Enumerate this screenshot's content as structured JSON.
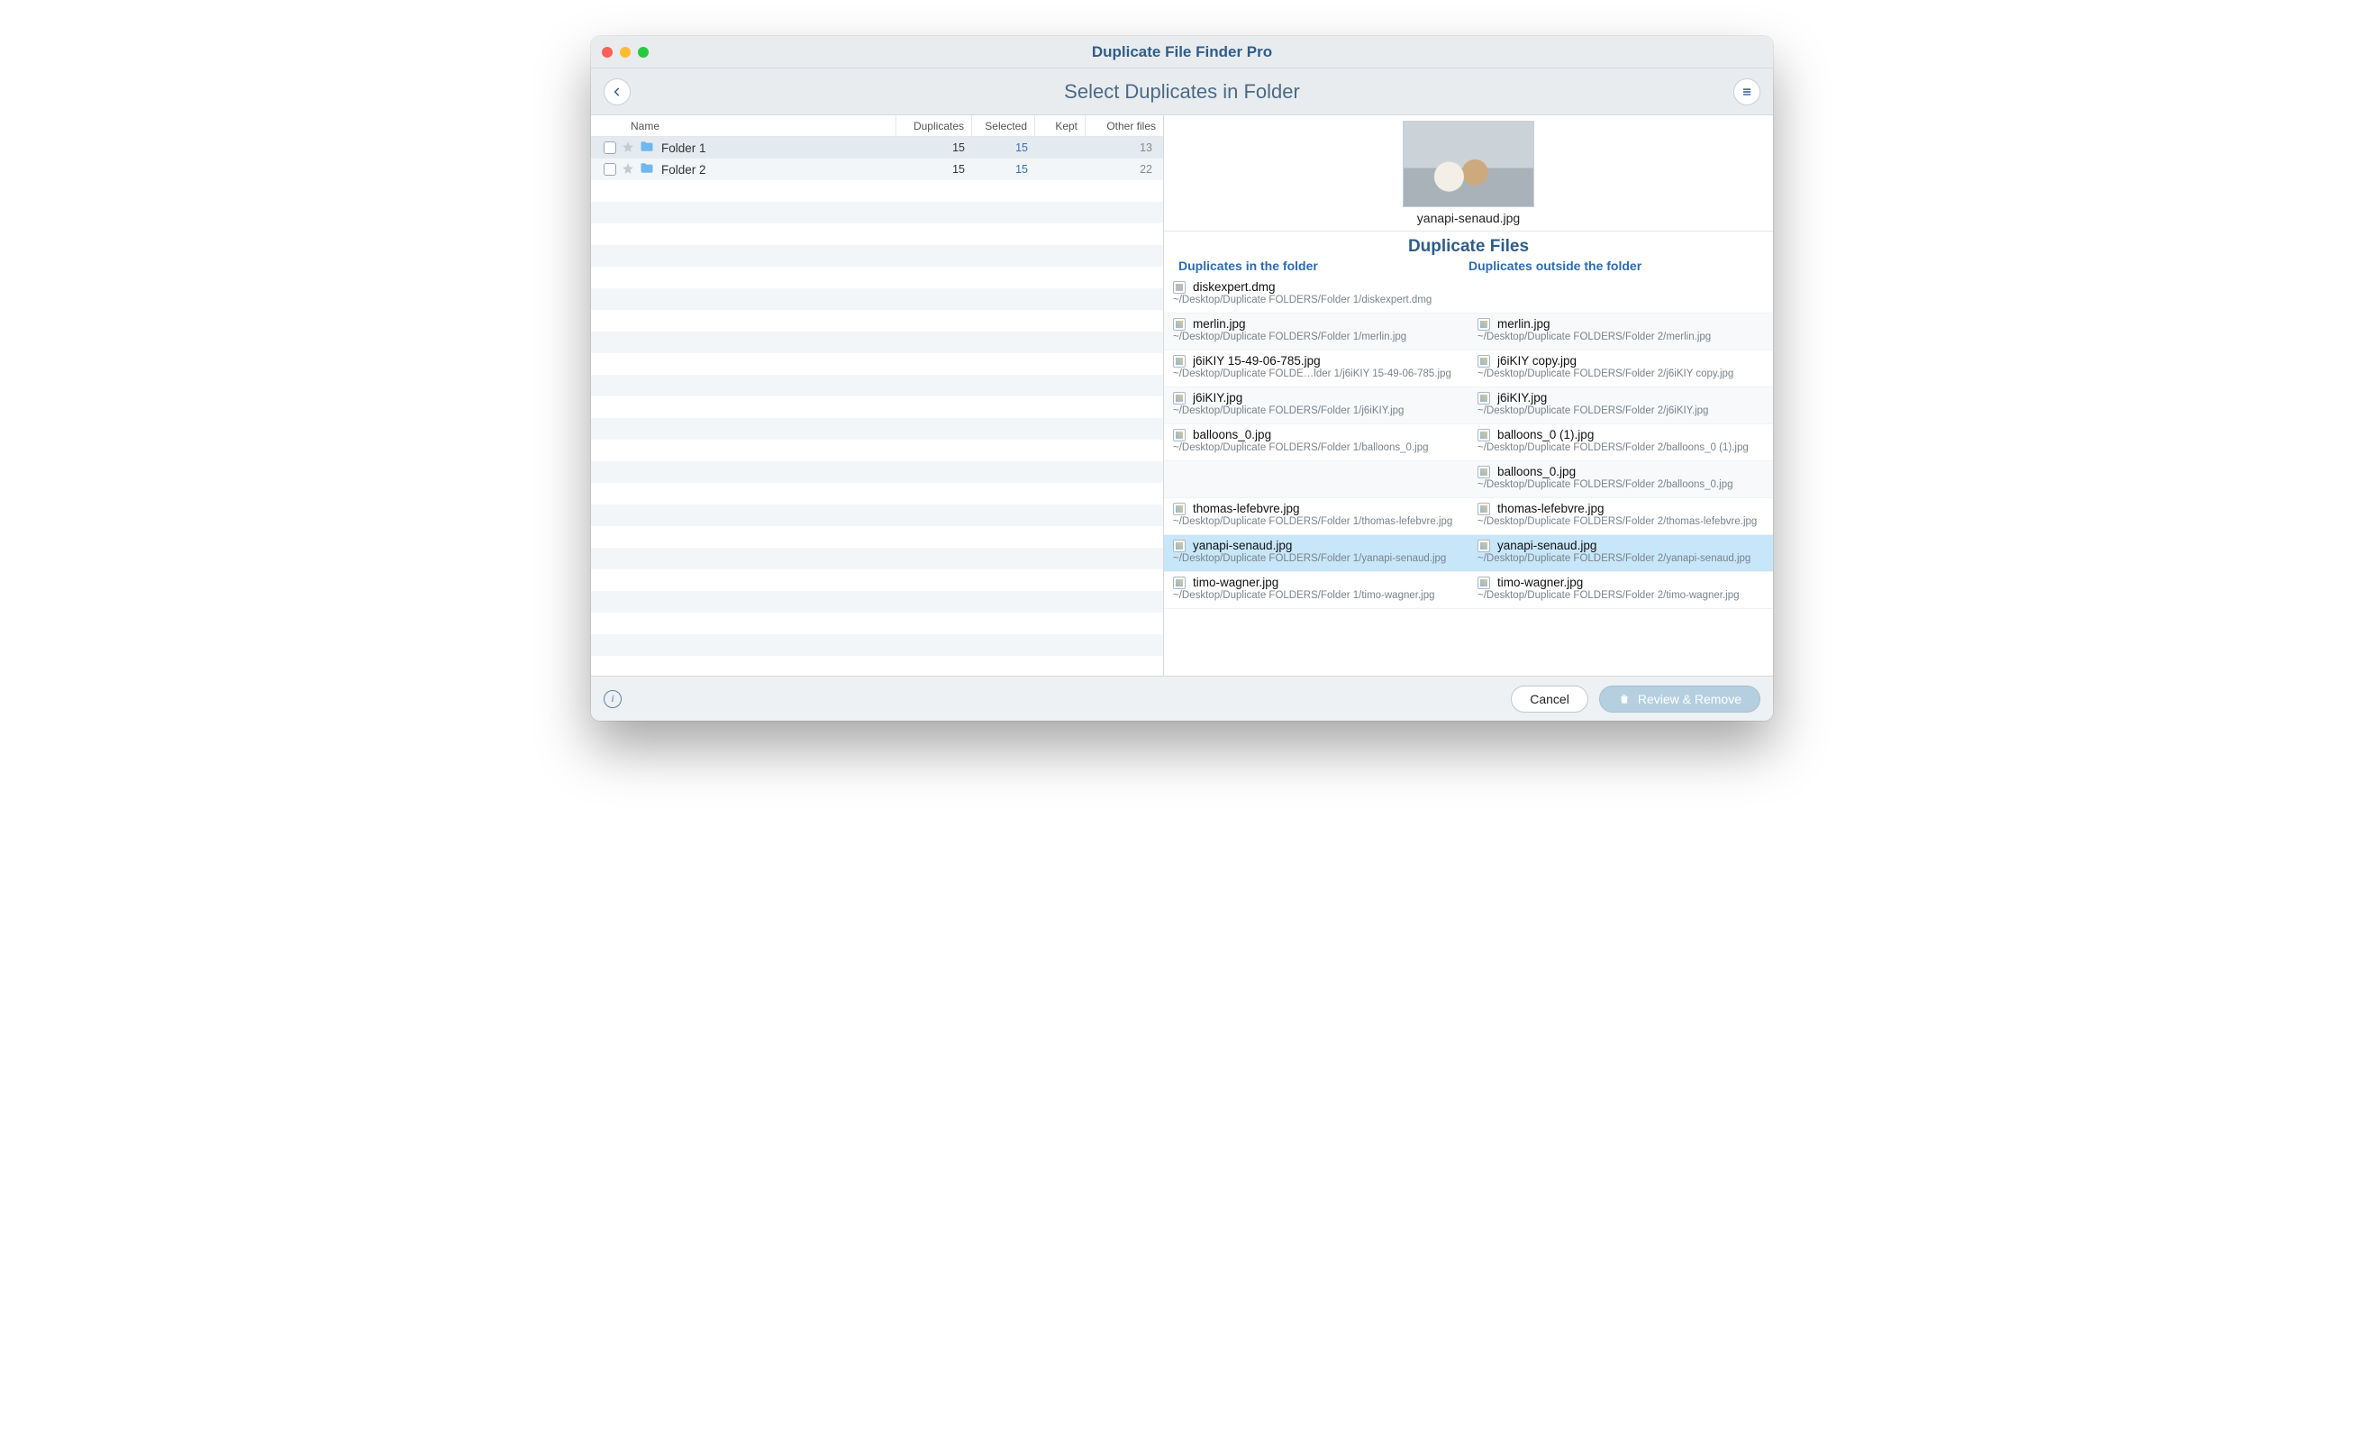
{
  "window": {
    "title": "Duplicate File Finder Pro"
  },
  "toolbar": {
    "subtitle": "Select Duplicates in Folder"
  },
  "left": {
    "headers": {
      "name": "Name",
      "duplicates": "Duplicates",
      "selected": "Selected",
      "kept": "Kept",
      "other": "Other files"
    },
    "folders": [
      {
        "name": "Folder 1",
        "duplicates": "15",
        "selected": "15",
        "kept": "",
        "other": "13",
        "selectedRow": true
      },
      {
        "name": "Folder 2",
        "duplicates": "15",
        "selected": "15",
        "kept": "",
        "other": "22",
        "selectedRow": false
      }
    ]
  },
  "preview": {
    "filename": "yanapi-senaud.jpg"
  },
  "right": {
    "section_title": "Duplicate Files",
    "col_inside": "Duplicates in the folder",
    "col_outside": "Duplicates outside the folder",
    "rows": [
      {
        "highlight": false,
        "inside": {
          "name": "diskexpert.dmg",
          "path": "~/Desktop/Duplicate FOLDERS/Folder 1/diskexpert.dmg",
          "icon": "dmg"
        },
        "outside": null
      },
      {
        "highlight": false,
        "inside": {
          "name": "merlin.jpg",
          "path": "~/Desktop/Duplicate FOLDERS/Folder 1/merlin.jpg",
          "icon": "img"
        },
        "outside": {
          "name": "merlin.jpg",
          "path": "~/Desktop/Duplicate FOLDERS/Folder 2/merlin.jpg",
          "icon": "img"
        }
      },
      {
        "highlight": false,
        "inside": {
          "name": "j6iKIY 15-49-06-785.jpg",
          "path": "~/Desktop/Duplicate FOLDE…lder 1/j6iKIY 15-49-06-785.jpg",
          "icon": "img"
        },
        "outside": {
          "name": "j6iKIY copy.jpg",
          "path": "~/Desktop/Duplicate FOLDERS/Folder 2/j6iKIY copy.jpg",
          "icon": "img"
        }
      },
      {
        "highlight": false,
        "inside": {
          "name": "j6iKIY.jpg",
          "path": "~/Desktop/Duplicate FOLDERS/Folder 1/j6iKIY.jpg",
          "icon": "img"
        },
        "outside": {
          "name": "j6iKIY.jpg",
          "path": "~/Desktop/Duplicate FOLDERS/Folder 2/j6iKIY.jpg",
          "icon": "img"
        }
      },
      {
        "highlight": false,
        "inside": {
          "name": "balloons_0.jpg",
          "path": "~/Desktop/Duplicate FOLDERS/Folder 1/balloons_0.jpg",
          "icon": "img"
        },
        "outside": {
          "name": "balloons_0 (1).jpg",
          "path": "~/Desktop/Duplicate FOLDERS/Folder 2/balloons_0 (1).jpg",
          "icon": "img"
        }
      },
      {
        "highlight": false,
        "inside": null,
        "outside": {
          "name": "balloons_0.jpg",
          "path": "~/Desktop/Duplicate FOLDERS/Folder 2/balloons_0.jpg",
          "icon": "img"
        }
      },
      {
        "highlight": false,
        "inside": {
          "name": "thomas-lefebvre.jpg",
          "path": "~/Desktop/Duplicate FOLDERS/Folder 1/thomas-lefebvre.jpg",
          "icon": "img"
        },
        "outside": {
          "name": "thomas-lefebvre.jpg",
          "path": "~/Desktop/Duplicate FOLDERS/Folder 2/thomas-lefebvre.jpg",
          "icon": "img"
        }
      },
      {
        "highlight": true,
        "inside": {
          "name": "yanapi-senaud.jpg",
          "path": "~/Desktop/Duplicate FOLDERS/Folder 1/yanapi-senaud.jpg",
          "icon": "img"
        },
        "outside": {
          "name": "yanapi-senaud.jpg",
          "path": "~/Desktop/Duplicate FOLDERS/Folder 2/yanapi-senaud.jpg",
          "icon": "img"
        }
      },
      {
        "highlight": false,
        "inside": {
          "name": "timo-wagner.jpg",
          "path": "~/Desktop/Duplicate FOLDERS/Folder 1/timo-wagner.jpg",
          "icon": "img"
        },
        "outside": {
          "name": "timo-wagner.jpg",
          "path": "~/Desktop/Duplicate FOLDERS/Folder 2/timo-wagner.jpg",
          "icon": "img"
        }
      }
    ]
  },
  "footer": {
    "cancel": "Cancel",
    "review": "Review & Remove"
  }
}
